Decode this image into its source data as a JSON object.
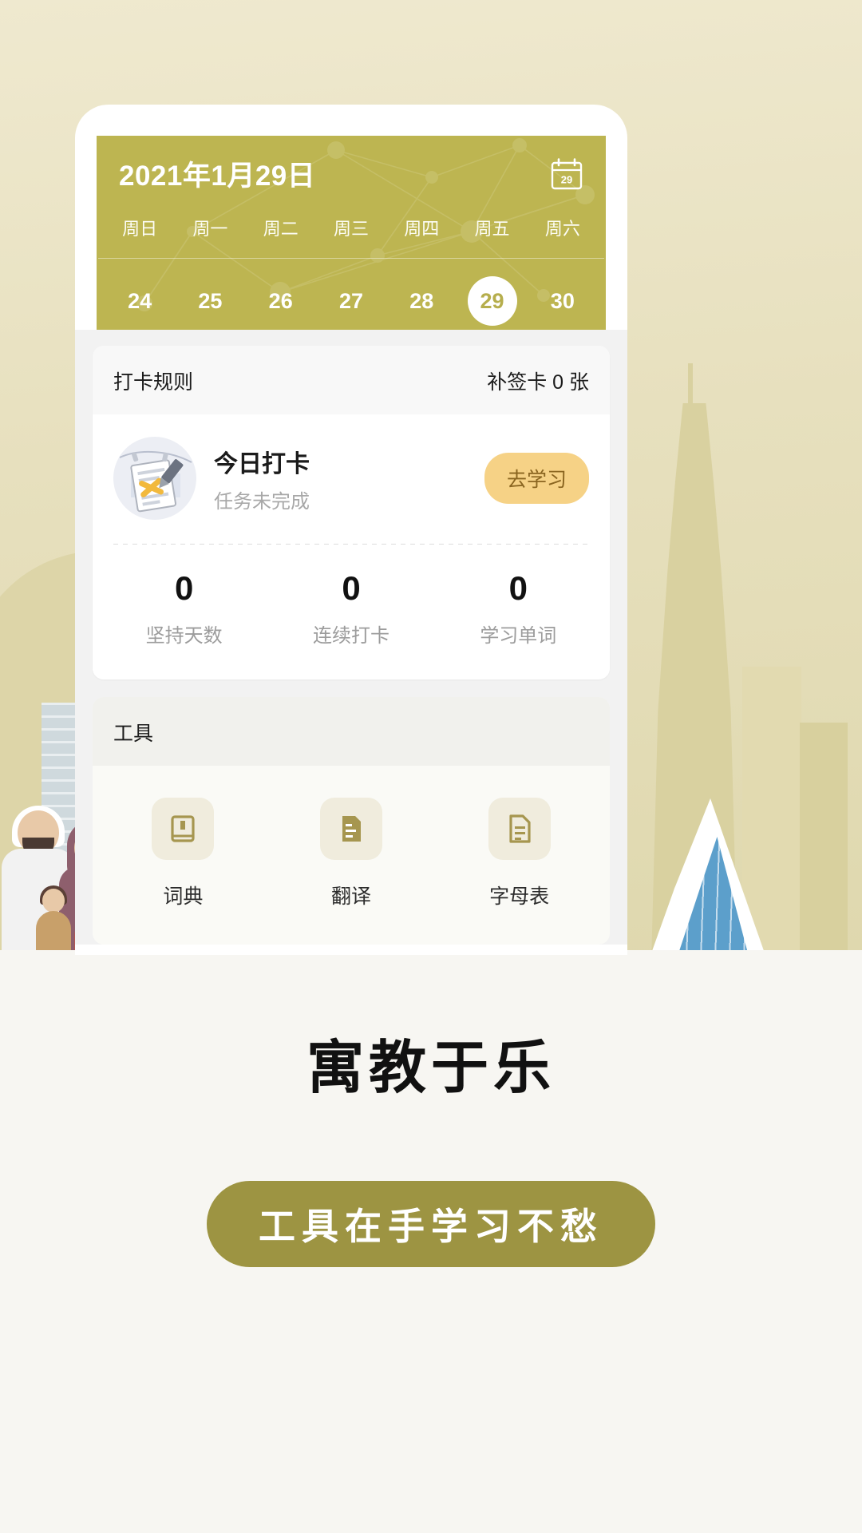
{
  "theme": {
    "header_olive": "#bdb551",
    "promo_olive": "#9d9442",
    "accent_amber": "#f6d286",
    "page_bg": "#f3efe0"
  },
  "calendar": {
    "date_title": "2021年1月29日",
    "calendar_icon": "calendar-29-icon",
    "calendar_icon_day": "29",
    "weekdays": [
      "周日",
      "周一",
      "周二",
      "周三",
      "周四",
      "周五",
      "周六"
    ],
    "days": [
      "24",
      "25",
      "26",
      "27",
      "28",
      "29",
      "30"
    ],
    "selected_day": "29",
    "expand_icon": "chevron-down-icon"
  },
  "checkin_card": {
    "rules_label": "打卡规则",
    "makeup_label": "补签卡 0 张",
    "task": {
      "title": "今日打卡",
      "subtitle": "任务未完成",
      "action_label": "去学习",
      "illustration": "checklist-paper-icon"
    },
    "stats": [
      {
        "value": "0",
        "label": "坚持天数"
      },
      {
        "value": "0",
        "label": "连续打卡"
      },
      {
        "value": "0",
        "label": "学习单词"
      }
    ]
  },
  "tools_card": {
    "title": "工具",
    "items": [
      {
        "label": "词典",
        "icon": "book-icon"
      },
      {
        "label": "翻译",
        "icon": "translate-document-icon"
      },
      {
        "label": "字母表",
        "icon": "document-lines-icon"
      }
    ]
  },
  "promo": {
    "headline": "寓教于乐",
    "button_label": "工具在手学习不愁"
  }
}
